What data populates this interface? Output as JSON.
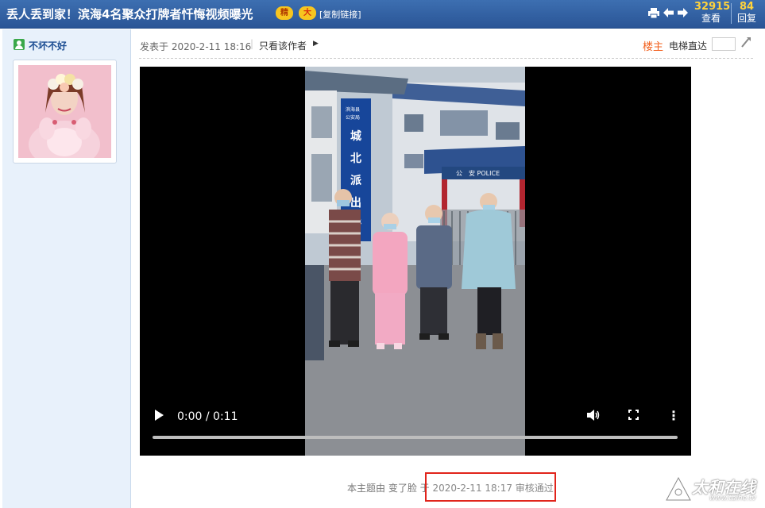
{
  "header": {
    "title": "丢人丢到家！滨海4名聚众打牌者忏悔视频曝光",
    "badge_hot": "精",
    "badge_big": "大",
    "copy_link": "[复制链接]",
    "views_count": "32915",
    "views_label": "查看",
    "replies_count": "84",
    "replies_label": "回复",
    "icons": [
      "print-icon",
      "arrow-left-icon",
      "arrow-right-icon"
    ]
  },
  "user": {
    "name": "不坏不好",
    "icon": "user-icon"
  },
  "post": {
    "posted_at": "发表于 2020-2-11 18:16",
    "separator": "|",
    "author_only": "只看该作者",
    "floor_label": "楼主",
    "elevator_label": "电梯直达",
    "elevator_value": ""
  },
  "video": {
    "time": "0:00 / 0:11",
    "progress": 0.0,
    "sign_vertical": "城北派出所",
    "sign_top_lines": [
      "滨海县",
      "公安局"
    ],
    "sign_horizontal": "公　安  POLICE"
  },
  "footer": {
    "prefix": "本主题由 变了脸 于",
    "review": "2020-2-11 18:17 审核通过"
  },
  "watermark": {
    "brand": "太和在线",
    "url": "www.taihe.tv"
  },
  "colors": {
    "header_bg": "#2f5d9f",
    "stat_number": "#ffd33c",
    "floor_label": "#f2601d",
    "highlight_border": "#e1241b",
    "sidebar_bg": "#e8f1fb"
  }
}
